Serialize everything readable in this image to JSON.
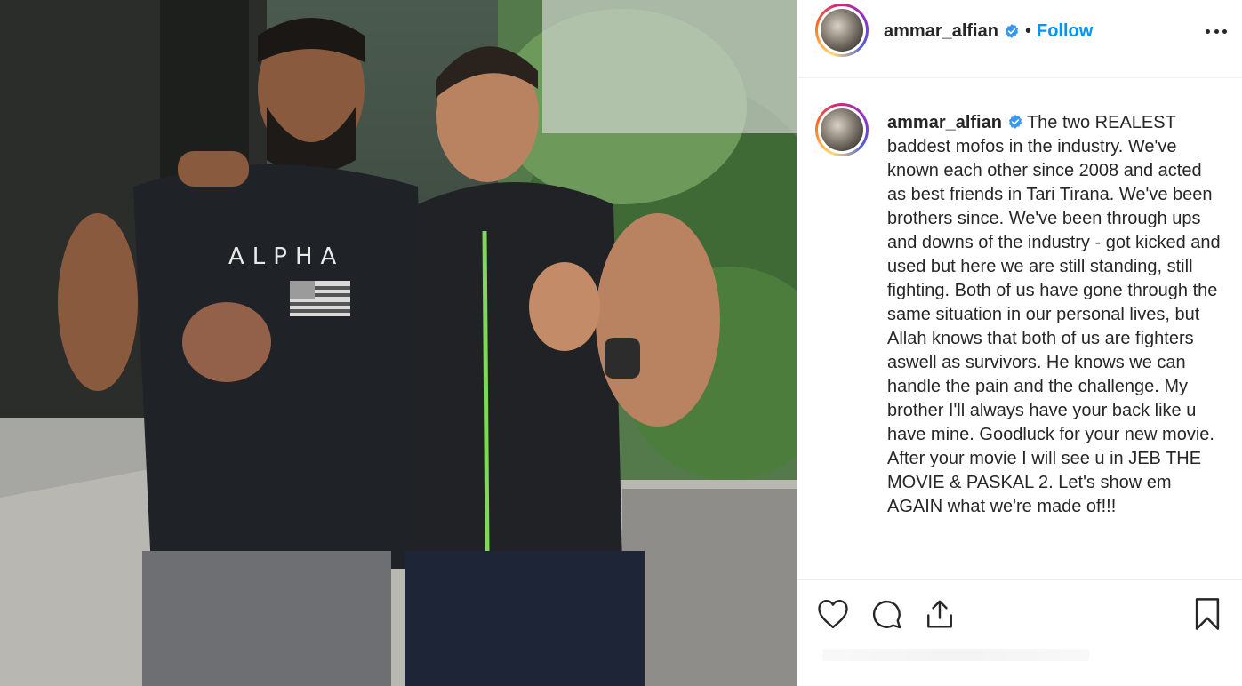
{
  "post": {
    "username": "ammar_alfian",
    "separator": "•",
    "follow_label": "Follow",
    "verified": true,
    "caption": "The two REALEST baddest mofos in the industry. We've known each other since 2008 and acted as best friends in Tari Tirana. We've been brothers since. We've been through ups and downs of the industry - got kicked and used but here we are still standing, still fighting. Both of us have gone through the same situation in our personal lives, but Allah knows that both of us are fighters aswell as survivors. He knows we can handle the pain and the challenge. My brother I'll always have your back like u have mine. Goodluck for your new movie. After your movie I will see u in JEB THE MOVIE & PASKAL 2. Let's show em AGAIN what we're made of!!!"
  },
  "photo": {
    "shirt_text": "ALPHA"
  },
  "icons": {
    "like": "heart-icon",
    "comment": "comment-icon",
    "share": "share-icon",
    "save": "bookmark-icon",
    "more": "more-options-icon",
    "verified": "verified-badge-icon"
  },
  "colors": {
    "follow_blue": "#0095f6",
    "verified_blue": "#3897f0",
    "text": "#262626",
    "divider": "#efefef"
  }
}
